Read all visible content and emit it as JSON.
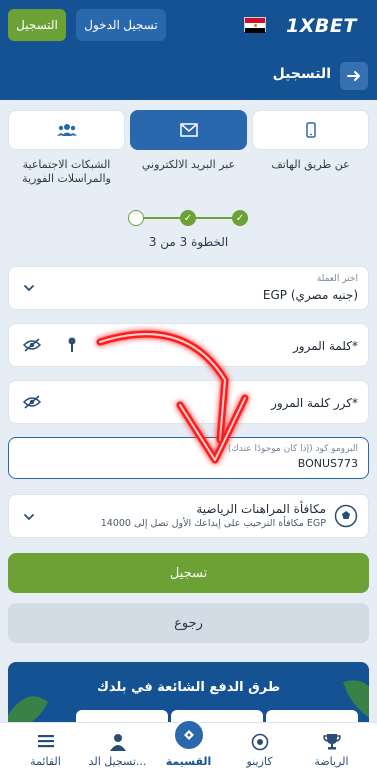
{
  "topbar": {
    "brand": "1XBET",
    "login_label": "تسجيل الدخول",
    "register_label": "التسجيل",
    "flag_colors": [
      "#ce1126",
      "#ffffff",
      "#000000"
    ]
  },
  "header": {
    "title": "التسجيل",
    "back_icon": "arrow-right-icon"
  },
  "tabs": [
    {
      "icon": "phone-icon",
      "label": "عن طريق الهاتف",
      "active": false
    },
    {
      "icon": "envelope-icon",
      "label": "عبر البريد الالكتروني",
      "active": true
    },
    {
      "icon": "users-icon",
      "label": "الشبكات الاجتماعية والمراسلات الفورية",
      "active": false
    }
  ],
  "steps": {
    "text": "الخطوة 3 من 3",
    "completed": 2,
    "total": 3
  },
  "form": {
    "currency_label": "اختر العملة",
    "currency_value": "EGP (جنيه مصري)",
    "password_placeholder": "كلمة المرور*",
    "confirm_password_placeholder": "كرر كلمة المرور*",
    "promo_label": "البرومو كود (إذا كان موجودًا عندك)",
    "promo_value": "BONUS773",
    "bonus_title": "مكافأة المراهنات الرياضية",
    "bonus_desc": "مكافأة الترحيب على إيداعك الأول تصل إلى 14000 EGP"
  },
  "buttons": {
    "register": "تسجيل",
    "back": "رجوع"
  },
  "payment": {
    "title": "طرق الدفع الشائعة في بلدك"
  },
  "bottom_nav": [
    {
      "icon": "menu-icon",
      "label": "القائمة"
    },
    {
      "icon": "user-icon",
      "label": "تسجيل الد..."
    },
    {
      "icon": "coupon-icon",
      "label": "القسيمة"
    },
    {
      "icon": "casino-chip-icon",
      "label": "كازينو"
    },
    {
      "icon": "trophy-icon",
      "label": "الرياضة"
    }
  ],
  "colors": {
    "primary": "#155293",
    "accent": "#2a68ad",
    "green": "#6ba135",
    "background": "#e7edf4"
  }
}
